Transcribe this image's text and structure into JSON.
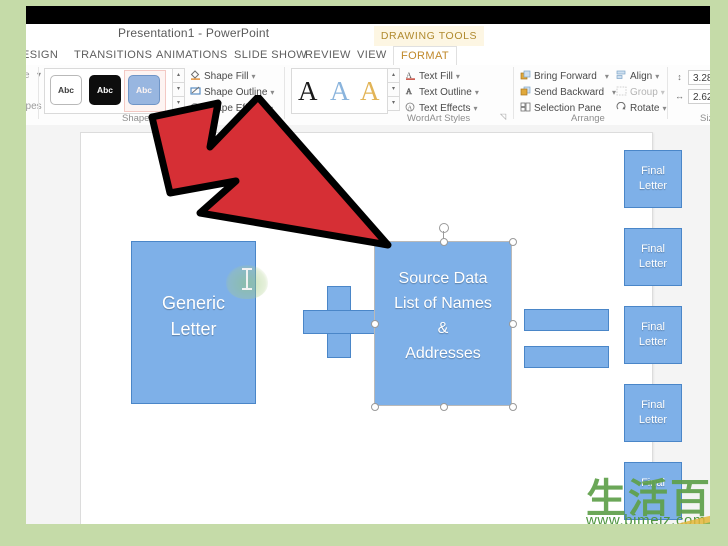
{
  "titlebar": {
    "document_title": "Presentation1 - PowerPoint",
    "contextual_tools": "DRAWING TOOLS"
  },
  "tabs": [
    {
      "label": "ESIGN",
      "active": false
    },
    {
      "label": "TRANSITIONS",
      "active": false
    },
    {
      "label": "ANIMATIONS",
      "active": false
    },
    {
      "label": "SLIDE SHOW",
      "active": false
    },
    {
      "label": "REVIEW",
      "active": false
    },
    {
      "label": "VIEW",
      "active": false
    },
    {
      "label": "FORMAT",
      "active": true
    }
  ],
  "ribbon": {
    "insert_shapes": {
      "edit_shape_label": "e",
      "shapes_label": "apes"
    },
    "shape_styles": {
      "group_label": "Shape Sty",
      "swatch_text": "Abc",
      "commands": [
        {
          "label": "Shape Fill",
          "icon": "paint-bucket-icon",
          "has_dropdown": true
        },
        {
          "label": "Shape Outline",
          "icon": "pencil-outline-icon",
          "has_dropdown": true
        },
        {
          "label": "Shape Effects",
          "icon": "shape-effects-icon",
          "has_dropdown": true
        }
      ]
    },
    "wordart_styles": {
      "group_label": "WordArt Styles",
      "sample_letter": "A",
      "commands": [
        {
          "label": "Text Fill",
          "icon": "text-fill-icon",
          "has_dropdown": true
        },
        {
          "label": "Text Outline",
          "icon": "text-outline-icon",
          "has_dropdown": true
        },
        {
          "label": "Text Effects",
          "icon": "text-effects-icon",
          "has_dropdown": true
        }
      ]
    },
    "arrange": {
      "group_label": "Arrange",
      "commands": [
        {
          "label": "Bring Forward",
          "icon": "bring-forward-icon",
          "has_dropdown": true,
          "disabled": false
        },
        {
          "label": "Send Backward",
          "icon": "send-backward-icon",
          "has_dropdown": true,
          "disabled": false
        },
        {
          "label": "Selection Pane",
          "icon": "selection-pane-icon",
          "has_dropdown": false,
          "disabled": false
        },
        {
          "label": "Align",
          "icon": "align-icon",
          "has_dropdown": true,
          "disabled": false
        },
        {
          "label": "Group",
          "icon": "group-icon",
          "has_dropdown": true,
          "disabled": true
        },
        {
          "label": "Rotate",
          "icon": "rotate-icon",
          "has_dropdown": true,
          "disabled": false
        }
      ]
    },
    "size": {
      "group_label": "Size",
      "height_value": "3.28\"",
      "width_value": "2.62\"",
      "height_icon": "shape-height-icon",
      "width_icon": "shape-width-icon"
    }
  },
  "slide": {
    "generic_letter": {
      "line1": "Generic",
      "line2": "Letter"
    },
    "plus_operator": "plus-shape",
    "source_data": {
      "line1": "Source Data",
      "line2": "List of Names",
      "line3": "&",
      "line4": "Addresses"
    },
    "blank_boxes": [
      "",
      ""
    ],
    "final_letters": [
      {
        "line1": "Final",
        "line2": "Letter"
      },
      {
        "line1": "Final",
        "line2": "Letter"
      },
      {
        "line1": "Final",
        "line2": "Letter"
      },
      {
        "line1": "Final",
        "line2": "Letter"
      },
      {
        "line1": "Final",
        "line2": ""
      }
    ]
  },
  "annotation": {
    "arrow": "red-arrow-pointer"
  },
  "watermark": {
    "cjk_text": "生活百科",
    "url_text": "www.bimeiz.com"
  },
  "colors": {
    "shape_fill": "#7eb0e8",
    "shape_outline": "#4a86c8",
    "accent_tab": "#c0882a",
    "frame_green": "#c5dba8",
    "arrow_red": "#d62f35",
    "watermark_green": "#5fa04a"
  }
}
